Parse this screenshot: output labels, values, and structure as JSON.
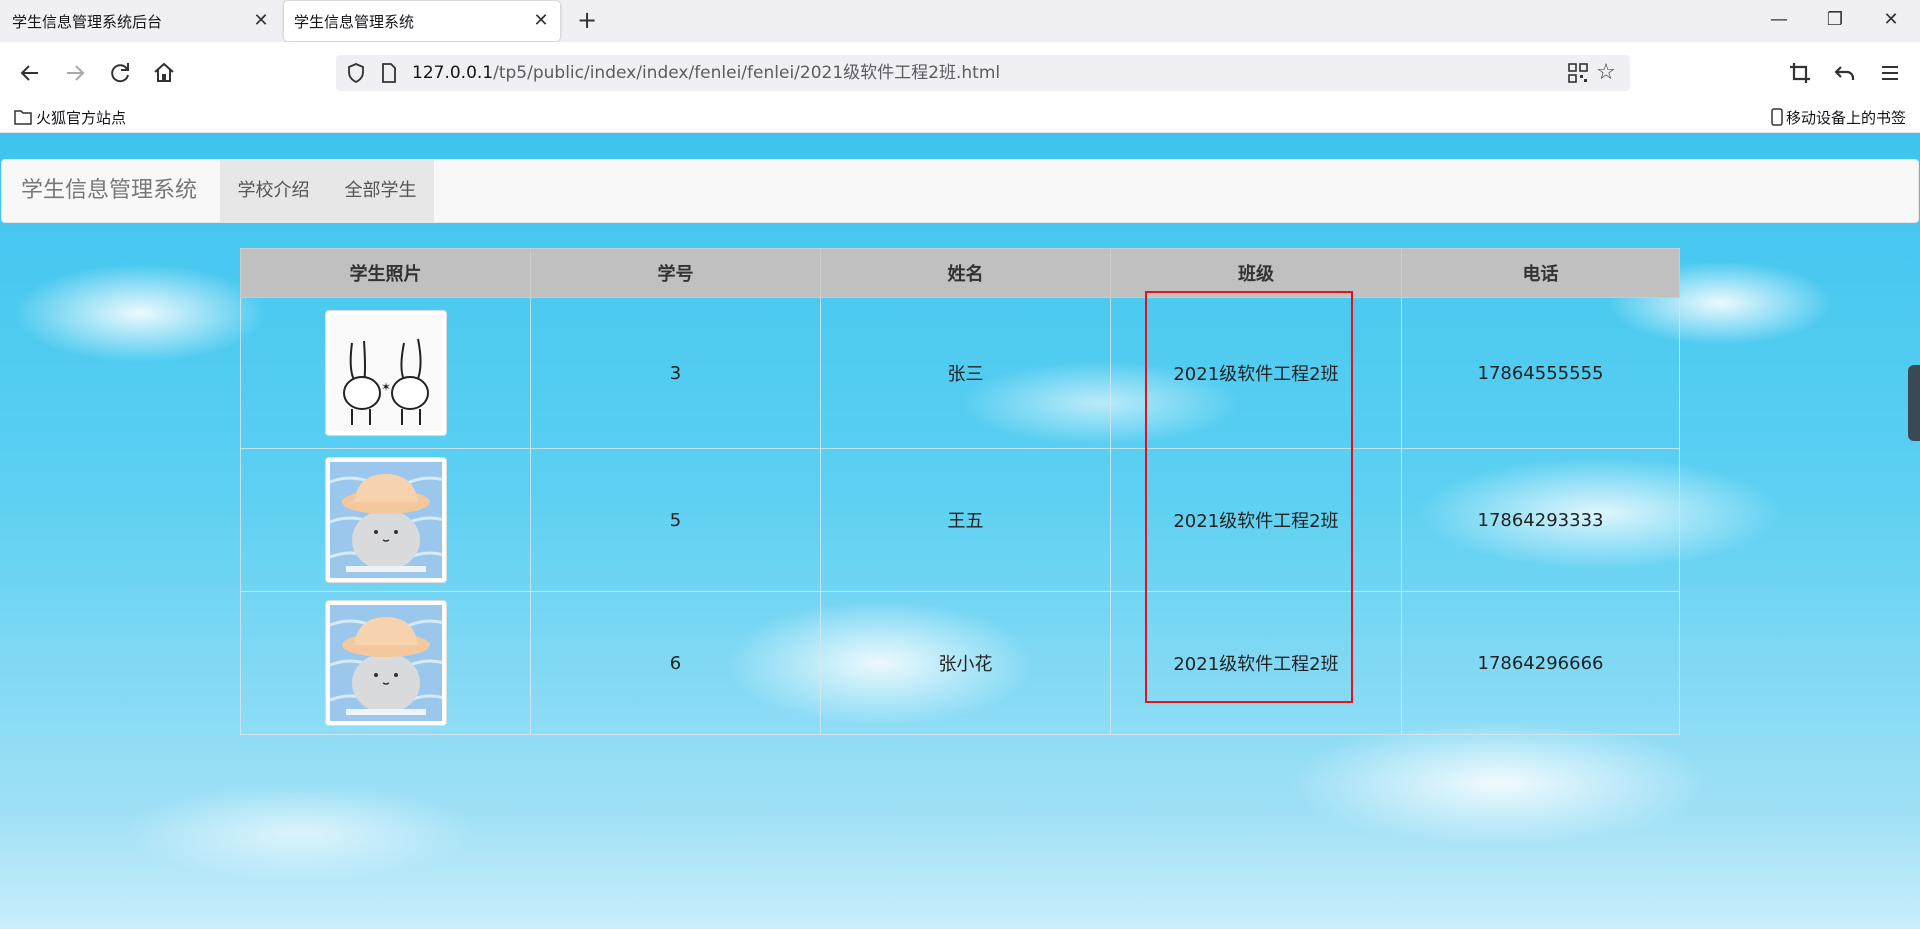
{
  "browser": {
    "tabs": [
      {
        "title": "学生信息管理系统后台",
        "close": "✕"
      },
      {
        "title": "学生信息管理系统",
        "close": "✕"
      }
    ],
    "new_tab": "+",
    "window": {
      "minimize": "—",
      "restore": "❐",
      "close": "✕"
    },
    "url": {
      "host": "127.0.0.1",
      "path": "/tp5/public/index/index/fenlei/fenlei/2021级软件工程2班.html"
    },
    "bookmarks": {
      "left": "火狐官方站点",
      "right": "移动设备上的书签"
    }
  },
  "site": {
    "brand": "学生信息管理系统",
    "nav": [
      "学校介绍",
      "全部学生"
    ]
  },
  "table": {
    "headers": [
      "学生照片",
      "学号",
      "姓名",
      "班级",
      "电话"
    ],
    "rows": [
      {
        "photo": "rabbit-sticker",
        "id": "3",
        "name": "张三",
        "class": "2021级软件工程2班",
        "phone": "17864555555"
      },
      {
        "photo": "bucket-hat-blob",
        "id": "5",
        "name": "王五",
        "class": "2021级软件工程2班",
        "phone": "17864293333"
      },
      {
        "photo": "bucket-hat-blob",
        "id": "6",
        "name": "张小花",
        "class": "2021级软件工程2班",
        "phone": "17864296666"
      }
    ]
  },
  "colors": {
    "highlight": "#e0141e",
    "header_bg": "#c0c0c0",
    "sky": "#3ec4ee"
  }
}
